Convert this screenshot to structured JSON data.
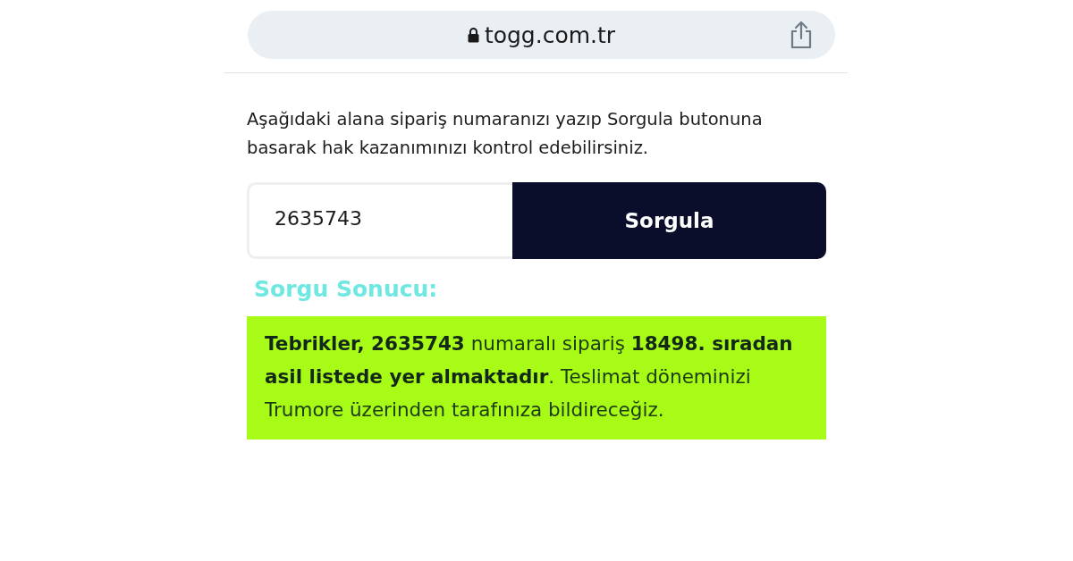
{
  "browser": {
    "address": "togg.com.tr"
  },
  "intro": "Aşağıdaki alana sipariş numaranızı yazıp Sorgula butonuna basarak hak kazanımınızı kontrol edebilirsiniz.",
  "query_form": {
    "order_number": "2635743",
    "button": "Sorgula"
  },
  "result": {
    "heading": "Sorgu Sonucu:",
    "message": "**Tebrikler, 2635743** numaralı sipariş **18498. sıradan asil listede yer almaktadır**. Teslimat döneminizi Trumore üzerinden tarafınıza bildireceğiz."
  }
}
